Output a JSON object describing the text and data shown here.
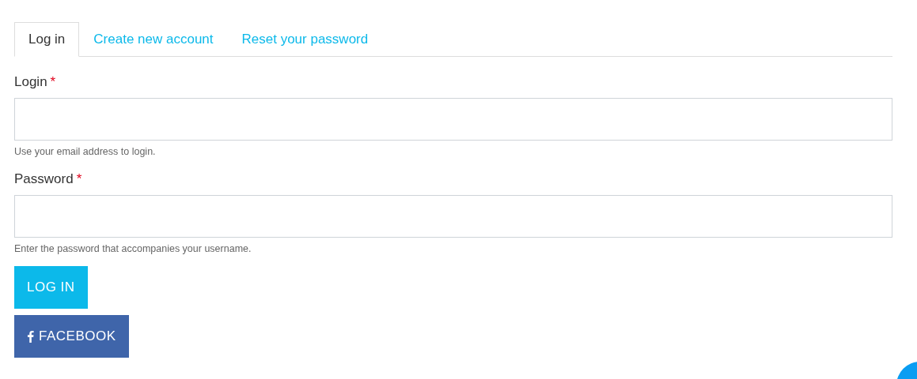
{
  "tabs": [
    {
      "label": "Log in",
      "selected": true
    },
    {
      "label": "Create new account",
      "selected": false
    },
    {
      "label": "Reset your password",
      "selected": false
    }
  ],
  "fields": [
    {
      "label": "Login",
      "required": "*",
      "description": "Use your email address to login."
    },
    {
      "label": "Password",
      "required": "*",
      "description": "Enter the password that accompanies your username."
    }
  ],
  "buttons": [
    {
      "label": "LOG IN",
      "kind": "submit"
    },
    {
      "label": "FACEBOOK",
      "kind": "facebook"
    }
  ]
}
